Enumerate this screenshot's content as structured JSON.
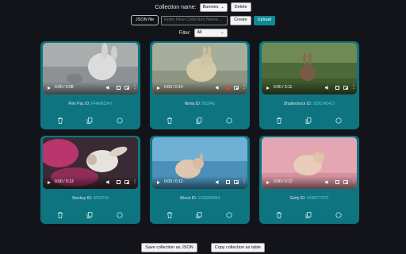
{
  "header": {
    "collection_label": "Collection name:",
    "collection_value": "Bunnies",
    "delete_label": "Delete",
    "json_file_label": "JSON file",
    "new_collection_placeholder": "Enter New Collection Name...",
    "create_label": "Create",
    "upload_label": "Upload",
    "filter_label": "Filter:",
    "filter_value": "All"
  },
  "cards": [
    {
      "time": "0:00 / 0:08",
      "source": "Film Pac ID:",
      "id": "FFAN83347"
    },
    {
      "time": "0:00 / 0:14",
      "source": "Nimia ID:",
      "id": "503941"
    },
    {
      "time": "0:00 / 0:11",
      "source": "Shutterstock ID:",
      "id": "1090143417"
    },
    {
      "time": "0:00 / 0:13",
      "source": "Stocksy ID:",
      "id": "5033739"
    },
    {
      "time": "0:00 / 0:13",
      "source": "iStock ID:",
      "id": "1428266894"
    },
    {
      "time": "0:00 / 0:12",
      "source": "Getty ID:",
      "id": "1438277972"
    }
  ],
  "footer": {
    "save_json_label": "Save collection as JSON",
    "copy_table_label": "Copy collection as table"
  },
  "colors": {
    "background": "#12141a",
    "card": "#0e7580",
    "accent": "#0f8a95",
    "id_text": "#5ad0e0"
  },
  "icons": [
    "trash-icon",
    "copy-icon",
    "circle-icon",
    "play-icon",
    "volume-icon",
    "fullscreen-icon",
    "pip-icon",
    "more-icon",
    "chevron-down-icon"
  ]
}
